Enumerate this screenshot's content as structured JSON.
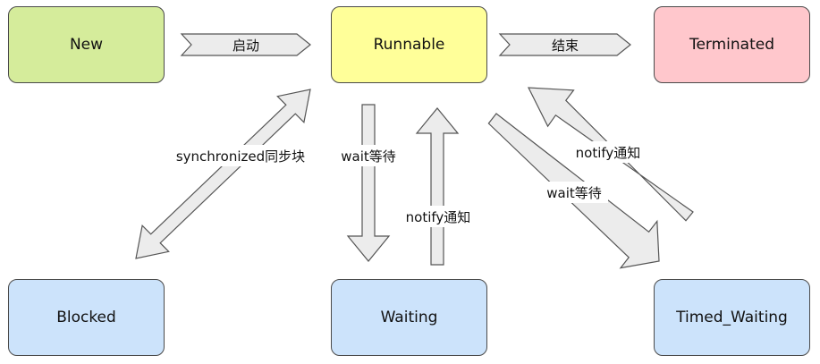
{
  "states": {
    "new": {
      "label": "New",
      "color": "#d5ec9b"
    },
    "runnable": {
      "label": "Runnable",
      "color": "#ffff99"
    },
    "terminated": {
      "label": "Terminated",
      "color": "#ffc7cc"
    },
    "blocked": {
      "label": "Blocked",
      "color": "#cce3fb"
    },
    "waiting": {
      "label": "Waiting",
      "color": "#cce3fb"
    },
    "timed_waiting": {
      "label": "Timed_Waiting",
      "color": "#cce3fb"
    }
  },
  "transitions": {
    "start": "启动",
    "end": "结束",
    "synchronized": "synchronized同步块",
    "wait": "wait等待",
    "notify": "notify通知",
    "timed_wait": "wait等待",
    "timed_notify": "notify通知"
  },
  "arrow_fill": "#ececec"
}
